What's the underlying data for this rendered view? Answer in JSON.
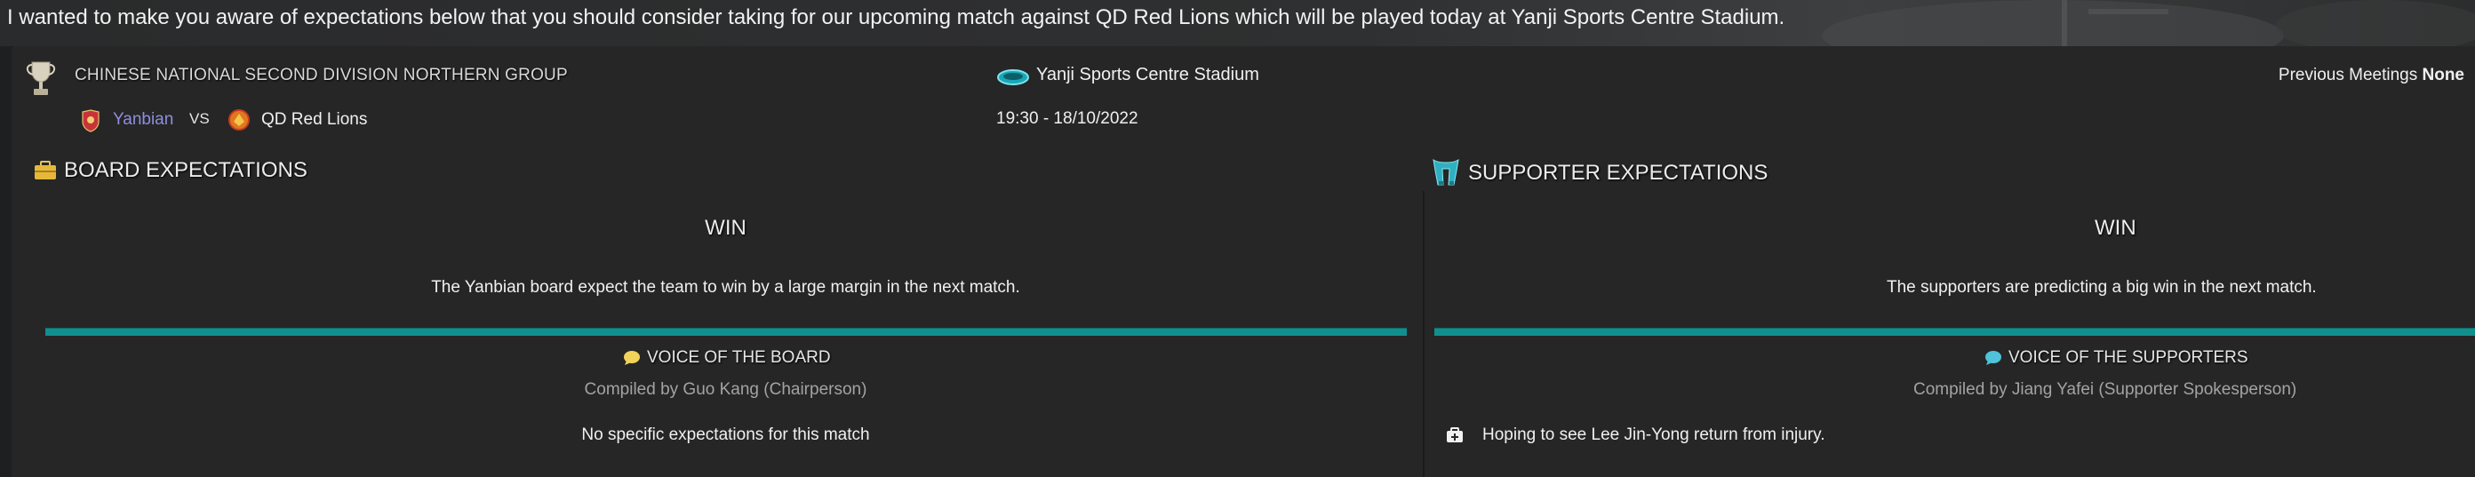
{
  "intro_text": "I wanted to make you aware of expectations below that you should consider taking for our upcoming match against QD Red Lions which will be played today at Yanji Sports Centre Stadium.",
  "match": {
    "competition": "CHINESE NATIONAL SECOND DIVISION NORTHERN GROUP",
    "home_team": "Yanbian",
    "vs": "VS",
    "away_team": "QD Red Lions",
    "stadium": "Yanji Sports Centre Stadium",
    "kickoff": "19:30 - 18/10/2022",
    "previous_meetings_label": "Previous Meetings",
    "previous_meetings_value": "None"
  },
  "board": {
    "title": "BOARD EXPECTATIONS",
    "verdict": "WIN",
    "description": "The Yanbian board expect the team to win by a large margin in the next match.",
    "voice_title": "VOICE OF THE BOARD",
    "compiled_by": "Compiled by Guo Kang (Chairperson)",
    "voice_text": "No specific expectations for this match"
  },
  "supporters": {
    "title": "SUPPORTER EXPECTATIONS",
    "verdict": "WIN",
    "description": "The supporters are predicting a big win in the next match.",
    "voice_title": "VOICE OF THE SUPPORTERS",
    "compiled_by": "Compiled by Jiang Yafei (Supporter Spokesperson)",
    "voice_text": "Hoping to see Lee Jin-Yong return from injury."
  },
  "icons": {
    "competition": "trophy-icon",
    "home_badge": "yanbian-badge-icon",
    "away_badge": "qd-red-lions-badge-icon",
    "stadium": "stadium-icon",
    "board": "briefcase-icon",
    "supporters": "scarf-icon",
    "board_voice": "speech-bubble-icon",
    "supporters_voice": "speech-bubble-icon",
    "injury": "medical-kit-icon"
  },
  "colors": {
    "accent_teal": "#138e8e",
    "home_team": "#8e8ee0",
    "board_bubble": "#f2d35a",
    "supporters_bubble": "#4fc3d9"
  }
}
